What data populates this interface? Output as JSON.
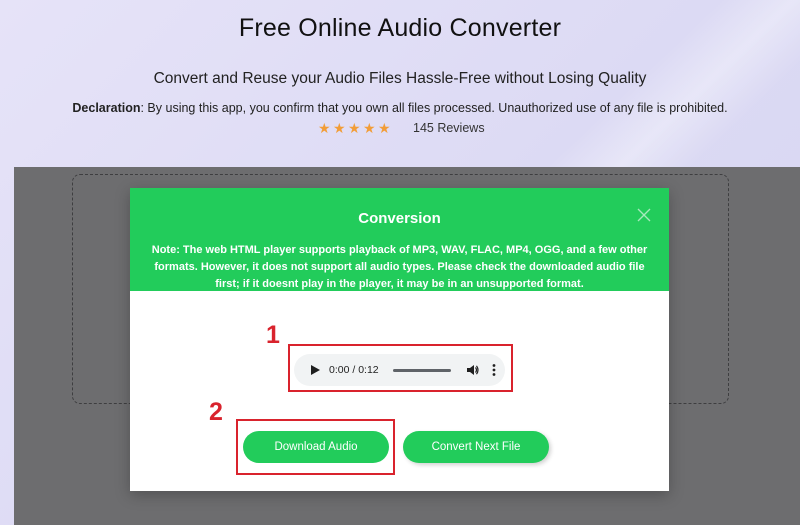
{
  "header": {
    "title": "Free Online Audio Converter",
    "subtitle": "Convert and Reuse your Audio Files Hassle-Free without Losing Quality",
    "declaration_label": "Declaration",
    "declaration_text": ": By using this app, you confirm that you own all files processed. Unauthorized use of any file is prohibited.",
    "rating": {
      "stars": 5,
      "reviews": "145 Reviews",
      "star_color": "#f29d38"
    }
  },
  "modal": {
    "title": "Conversion",
    "note": "Note: The web HTML player supports playback of MP3, WAV, FLAC, MP4, OGG, and a few other formats. However, it does not support all audio types. Please check the downloaded audio file first; if it doesnt play in the player, it may be in an unsupported format.",
    "header_color": "#22cc5b",
    "player": {
      "time": "0:00 / 0:12",
      "progress": 0
    },
    "buttons": {
      "download": "Download Audio",
      "convert_next": "Convert Next File"
    }
  },
  "annotations": {
    "label_1": "1",
    "label_2": "2",
    "color": "#d9232d"
  },
  "icons": [
    "star-icon",
    "close-icon",
    "play-icon",
    "volume-icon",
    "more-vertical-icon"
  ]
}
